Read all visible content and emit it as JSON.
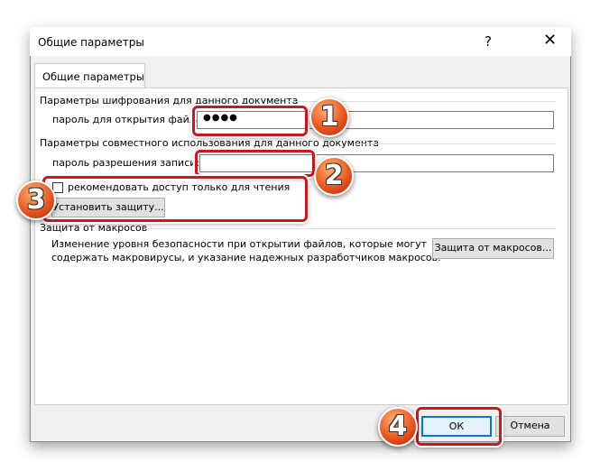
{
  "window": {
    "title": "Общие параметры",
    "help": "?",
    "close": "✕"
  },
  "tab": "Общие параметры",
  "encryption": {
    "header": "Параметры шифрования для данного документа",
    "label": "пароль для открытия файла:",
    "value": "●●●●"
  },
  "sharing": {
    "header": "Параметры совместного использования для данного документа",
    "label": "пароль разрешения записи:",
    "value": "",
    "readonly_label": "рекомендовать доступ только для чтения",
    "protect_button": "Установить защиту..."
  },
  "macro": {
    "header": "Защита от макросов",
    "text1": "Изменение уровня безопасности при открытии файлов, которые могут",
    "text2": "содержать макровирусы, и указание надежных разработчиков макросов.",
    "button": "Защита от макросов..."
  },
  "buttons": {
    "ok": "ОК",
    "cancel": "Отмена"
  },
  "annotations": [
    "1",
    "2",
    "3",
    "4"
  ],
  "colors": {
    "highlight": "#d4141c",
    "badge": "#e8501a",
    "ok_border": "#0078d7"
  }
}
